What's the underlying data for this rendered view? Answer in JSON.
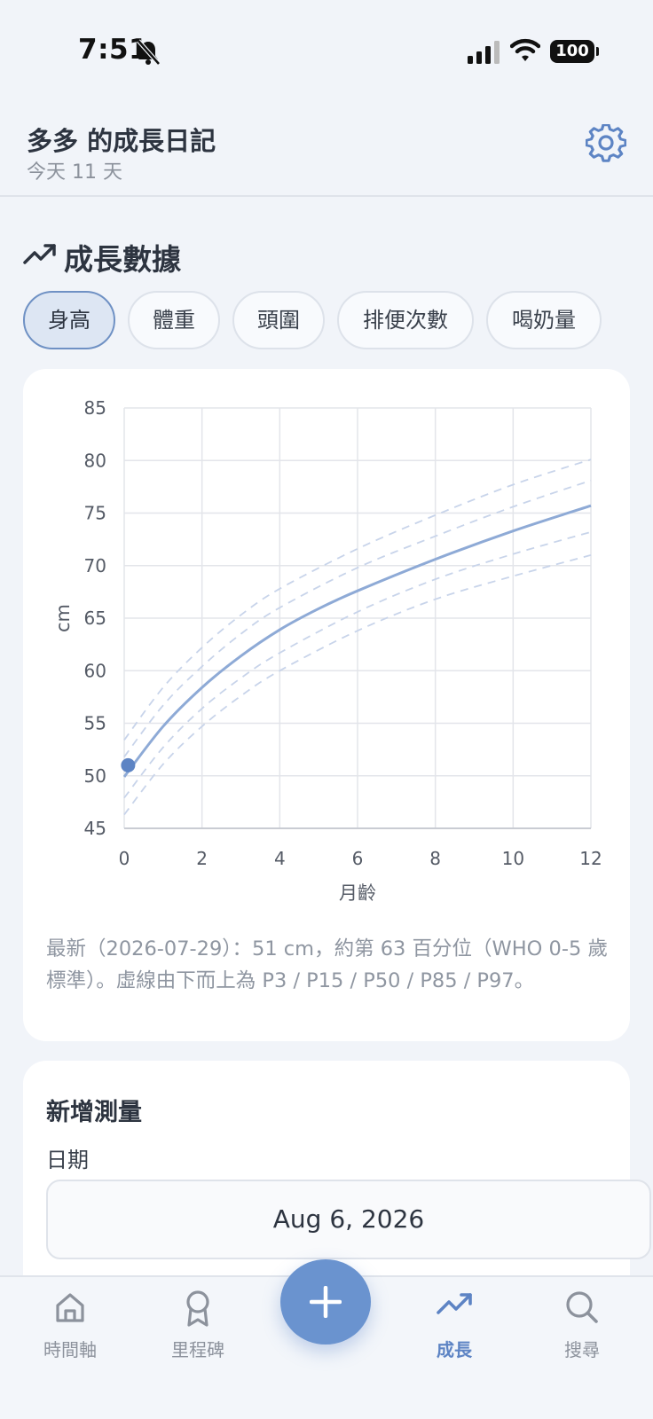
{
  "status_bar": {
    "time": "7:51",
    "battery": "100"
  },
  "header": {
    "title": "多多 的成長日記",
    "subtitle": "今天 11 天"
  },
  "section": {
    "title": "成長數據"
  },
  "tabs": [
    {
      "label": "身高",
      "active": true
    },
    {
      "label": "體重",
      "active": false
    },
    {
      "label": "頭圍",
      "active": false
    },
    {
      "label": "排便次數",
      "active": false
    },
    {
      "label": "喝奶量",
      "active": false
    }
  ],
  "chart_data": {
    "type": "line",
    "xlabel": "月齡",
    "ylabel": "cm",
    "xlim": [
      0,
      12
    ],
    "ylim": [
      45,
      85
    ],
    "x_ticks": [
      "0",
      "2",
      "4",
      "6",
      "8",
      "10",
      "12"
    ],
    "y_ticks": [
      "45",
      "50",
      "55",
      "60",
      "65",
      "70",
      "75",
      "80",
      "85"
    ],
    "grid": true,
    "series": [
      {
        "role": "percentile",
        "style": "dashed",
        "x": [
          0,
          1,
          2,
          3,
          4,
          6,
          8,
          10,
          12
        ],
        "y": [
          46.3,
          51.1,
          54.7,
          57.6,
          60.0,
          63.8,
          66.8,
          69.0,
          71.0
        ]
      },
      {
        "role": "percentile",
        "style": "dashed",
        "x": [
          0,
          1,
          2,
          3,
          4,
          6,
          8,
          10,
          12
        ],
        "y": [
          47.9,
          52.7,
          56.4,
          59.3,
          61.7,
          65.6,
          68.7,
          71.1,
          73.2
        ]
      },
      {
        "role": "percentile",
        "style": "solid",
        "x": [
          0,
          1,
          2,
          3,
          4,
          5,
          6,
          8,
          10,
          12
        ],
        "y": [
          49.9,
          54.7,
          58.4,
          61.4,
          63.9,
          65.9,
          67.6,
          70.6,
          73.3,
          75.7
        ]
      },
      {
        "role": "percentile",
        "style": "dashed",
        "x": [
          0,
          1,
          2,
          3,
          4,
          6,
          8,
          10,
          12
        ],
        "y": [
          51.8,
          56.7,
          60.4,
          63.5,
          66.0,
          69.8,
          72.8,
          75.6,
          78.1
        ]
      },
      {
        "role": "percentile",
        "style": "dashed",
        "x": [
          0,
          1,
          2,
          3,
          4,
          6,
          8,
          10,
          12
        ],
        "y": [
          53.4,
          58.4,
          62.2,
          65.3,
          67.8,
          71.6,
          74.8,
          77.7,
          80.1
        ]
      }
    ],
    "points": [
      {
        "x": 0.1,
        "y": 51
      }
    ]
  },
  "chart_note": "最新（2026-07-29）：51 cm，約第 63 百分位（WHO 0-5 歲標準）。虛線由下而上為 P3 / P15 / P50 / P85 / P97。",
  "add_measurement": {
    "title": "新增測量",
    "date_label": "日期",
    "date_value": "Aug 6, 2026"
  },
  "nav": {
    "items": [
      {
        "label": "時間軸",
        "icon": "home-icon",
        "active": false
      },
      {
        "label": "里程碑",
        "icon": "award-icon",
        "active": false
      },
      {
        "label": "成長",
        "icon": "trend-icon",
        "active": true
      },
      {
        "label": "搜尋",
        "icon": "search-icon",
        "active": false
      }
    ]
  },
  "colors": {
    "accent": "#5d84c4",
    "fab": "#6a93cf",
    "background": "#f1f4f9"
  }
}
